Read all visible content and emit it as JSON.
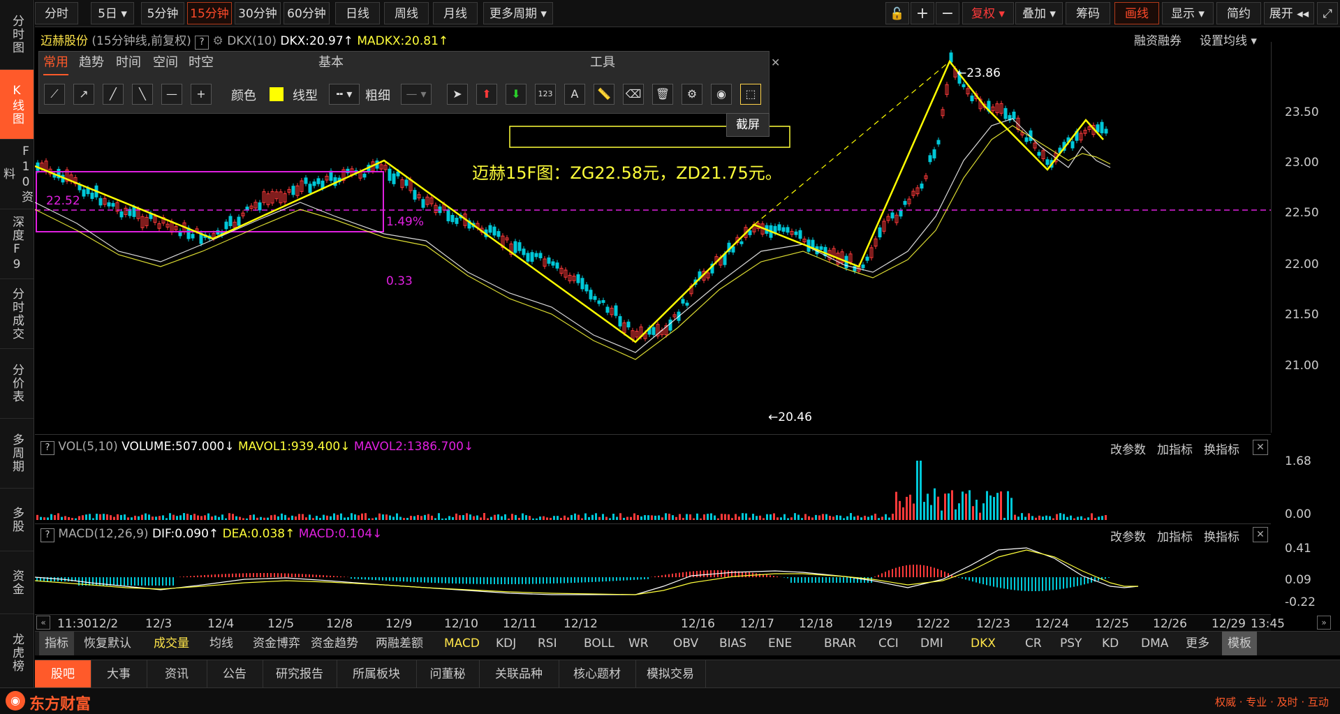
{
  "period_tabs": [
    "分时",
    "5日",
    "5分钟",
    "15分钟",
    "30分钟",
    "60分钟",
    "日线",
    "周线",
    "月线",
    "更多周期"
  ],
  "active_period": "15分钟",
  "right_toolbar": {
    "fuquan": "复权",
    "diejia": "叠加",
    "chouma": "筹码",
    "huaxian": "画线",
    "xianshi": "显示",
    "jianyue": "简约",
    "zhankai": "展开"
  },
  "sidebar": [
    "分时图",
    "K线图",
    "F10资料",
    "深度F9",
    "分时成交",
    "分价表",
    "多周期",
    "多股",
    "资金",
    "龙虎榜"
  ],
  "stock": {
    "name": "迈赫股份",
    "mode": "(15分钟线,前复权)",
    "indicator": "DKX(10)",
    "dkx": "DKX:20.97",
    "madkx": "MADKX:20.81",
    "arrow_up": "↑",
    "links": [
      "融资融券",
      "设置均线"
    ]
  },
  "toolbox": {
    "tabs": [
      "常用",
      "趋势",
      "时间",
      "空间",
      "时空"
    ],
    "section_basic": "基本",
    "section_tools": "工具",
    "color_label": "颜色",
    "linetype_label": "线型",
    "width_label": "粗细",
    "tooltip": "截屏",
    "close": "✕"
  },
  "annotations": {
    "note": "迈赫15F图：ZG22.58元，ZD21.75元。",
    "high_left": "22.52",
    "pct": "1.49%",
    "diff": "0.33",
    "peak": "23.86",
    "trough": "20.46"
  },
  "price_axis": [
    "23.50",
    "23.00",
    "22.50",
    "22.00",
    "21.50",
    "21.00"
  ],
  "vol_panel": {
    "title": "VOL(5,10)",
    "volume": "VOLUME:507.000",
    "mavol1": "MAVOL1:939.400",
    "mavol2": "MAVOL2:1386.700",
    "down": "↓",
    "axis": [
      "1.68",
      "0.00"
    ],
    "links": [
      "改参数",
      "加指标",
      "换指标"
    ]
  },
  "macd_panel": {
    "title": "MACD(12,26,9)",
    "dif": "DIF:0.090",
    "dea": "DEA:0.038",
    "macd": "MACD:0.104",
    "down": "↓",
    "up": "↑",
    "axis": [
      "0.41",
      "0.09",
      "-0.22"
    ],
    "links": [
      "改参数",
      "加指标",
      "换指标"
    ]
  },
  "dates": [
    "11:30",
    "12/2",
    "12/3",
    "12/4",
    "12/5",
    "12/8",
    "12/9",
    "12/10",
    "12/11",
    "12/12",
    "12/16",
    "12/17",
    "12/18",
    "12/19",
    "12/22",
    "12/23",
    "12/24",
    "12/25",
    "12/26",
    "12/29",
    "13:45"
  ],
  "indicators": [
    "指标",
    "恢复默认",
    "成交量",
    "均线",
    "资金博弈",
    "资金趋势",
    "两融差额",
    "MACD",
    "KDJ",
    "RSI",
    "BOLL",
    "WR",
    "OBV",
    "BIAS",
    "ENE",
    "BRAR",
    "CCI",
    "DMI",
    "DKX",
    "CR",
    "PSY",
    "KD",
    "DMA",
    "更多",
    "模板"
  ],
  "news_tabs": [
    "股吧",
    "大事",
    "资讯",
    "公告",
    "研究报告",
    "所属板块",
    "问董秘",
    "关联品种",
    "核心题材",
    "模拟交易"
  ],
  "footer": {
    "brand": "东方财富",
    "slogan": "权威 · 专业 · 及时 · 互动"
  },
  "colors": {
    "accent": "#ff5a2a",
    "yellow": "#ffff00",
    "magenta": "#e020e0",
    "up": "#ff3a3a",
    "down": "#00c8d8"
  }
}
